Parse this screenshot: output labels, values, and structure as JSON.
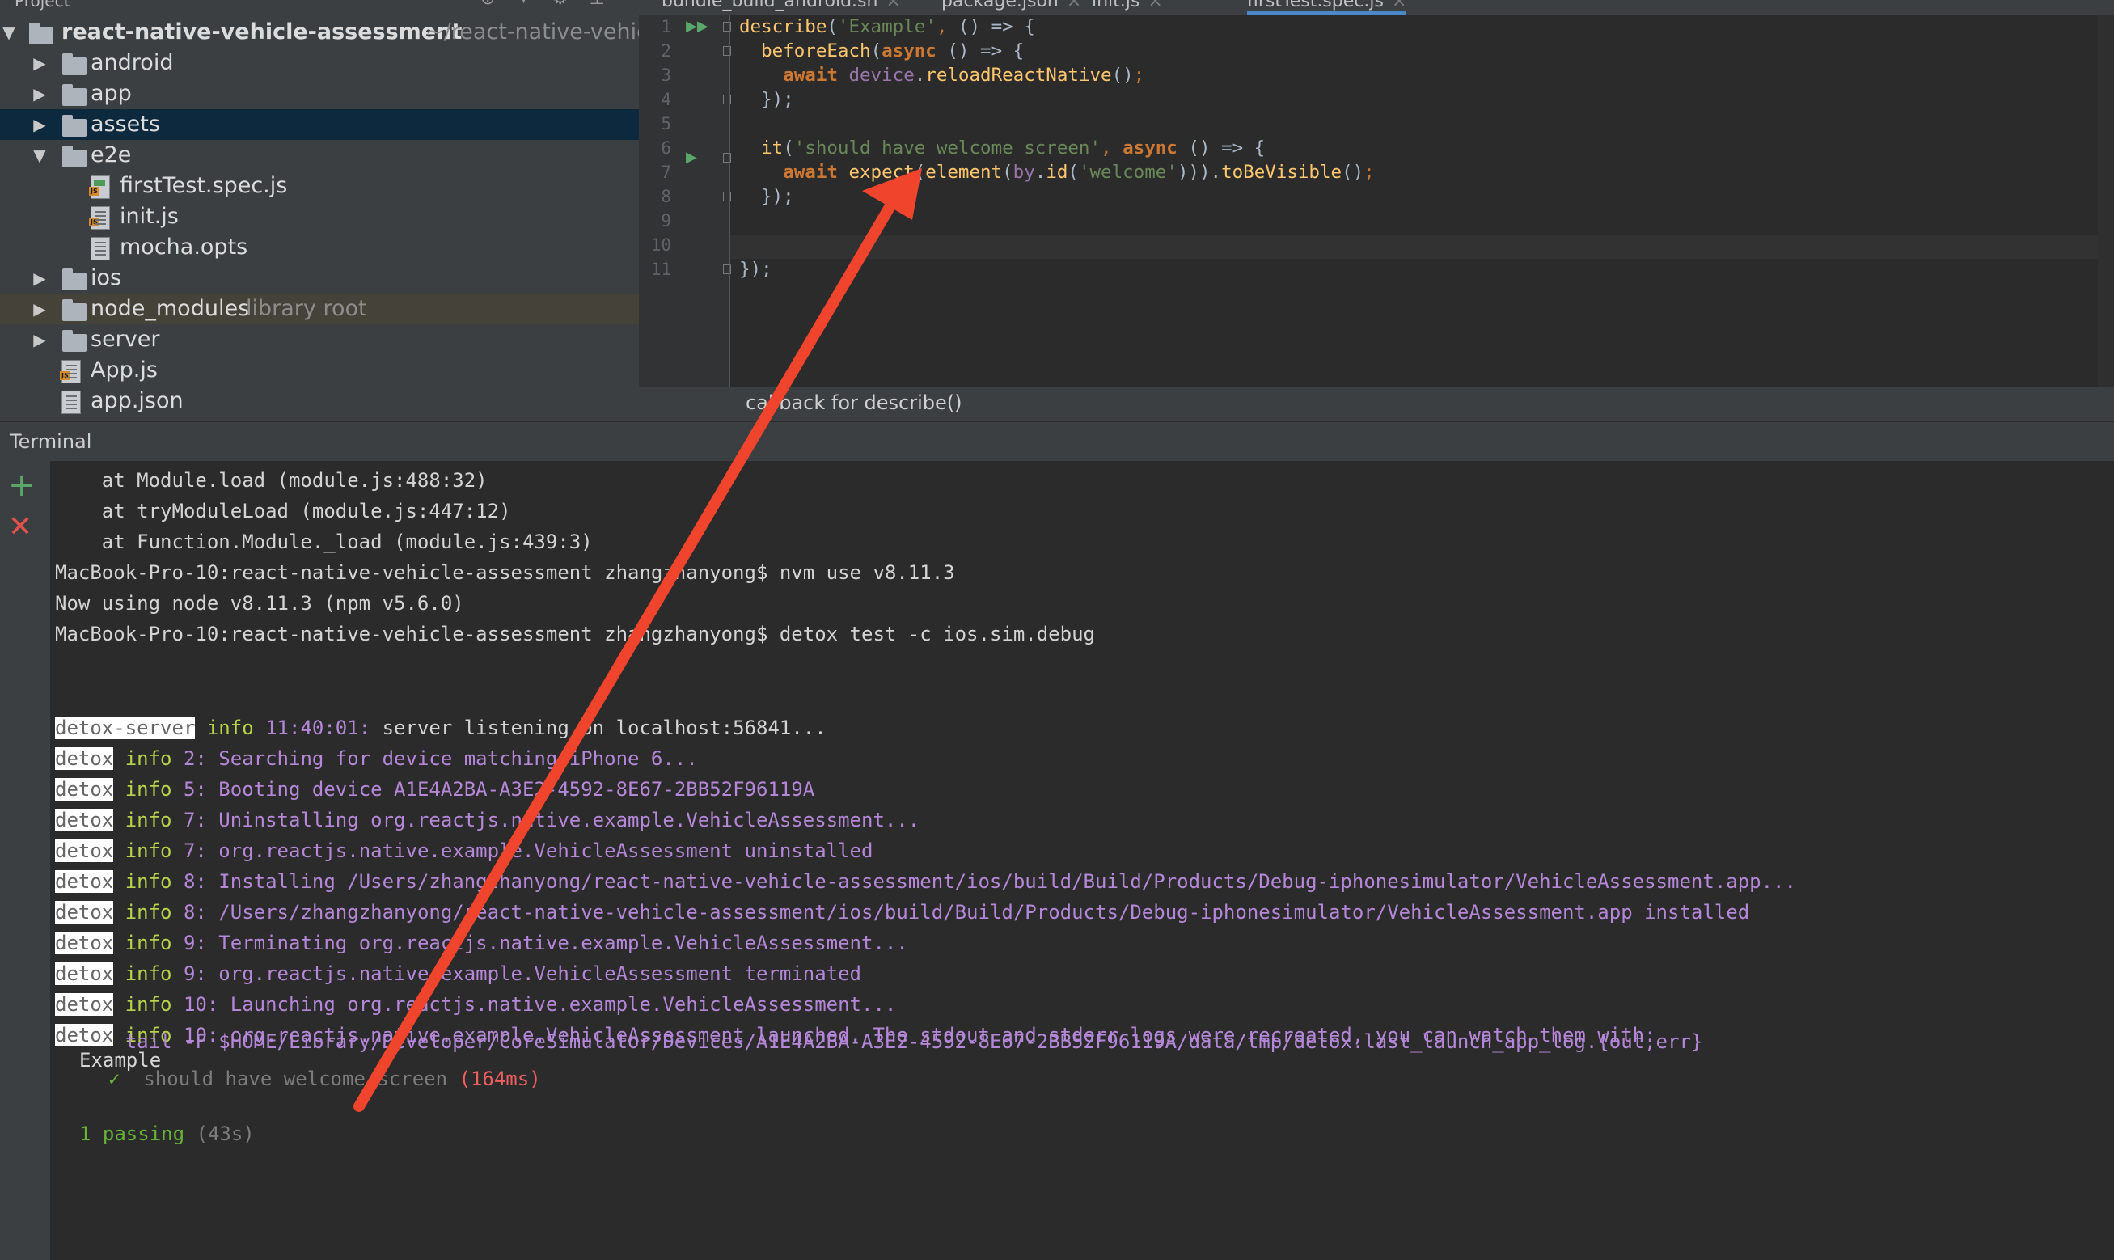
{
  "project": {
    "header_label": "Project",
    "root_name": "react-native-vehicle-assessment",
    "root_path": "~/react-native-vehicle-assessment",
    "items": [
      {
        "label": "android"
      },
      {
        "label": "app"
      },
      {
        "label": "assets"
      },
      {
        "label": "e2e"
      },
      {
        "label": "firstTest.spec.js"
      },
      {
        "label": "init.js"
      },
      {
        "label": "mocha.opts"
      },
      {
        "label": "ios"
      },
      {
        "label": "node_modules",
        "hint": "library root"
      },
      {
        "label": "server"
      },
      {
        "label": "App.js"
      },
      {
        "label": "app.json"
      }
    ],
    "file_tag": "JS"
  },
  "editor": {
    "tabs": [
      {
        "label": "bundle_build_android.sh"
      },
      {
        "label": "package.json"
      },
      {
        "label": "init.js"
      },
      {
        "label": "firstTest.spec.js",
        "active": true
      }
    ],
    "line_numbers": [
      "1",
      "2",
      "3",
      "4",
      "5",
      "6",
      "7",
      "8",
      "9",
      "10",
      "11"
    ],
    "code": {
      "l1_fn": "describe",
      "l1_str": "'Example'",
      "l1_rest": " () => {",
      "l2_fn": "beforeEach",
      "l2_kw": "async",
      "l2_rest": " () => {",
      "l3_kw": "await",
      "l3_var": "device",
      "l3_fn": "reloadReactNative",
      "l4": "});",
      "l6_fn": "it",
      "l6_str": "'should have welcome screen'",
      "l6_kw": "async",
      "l6_rest": " () => {",
      "l7_kw": "await",
      "l7_fn1": "expect",
      "l7_fn2": "element",
      "l7_var": "by",
      "l7_fn3": "id",
      "l7_str": "'welcome'",
      "l7_fn4": "toBeVisible",
      "l8": "});",
      "l11": "});"
    },
    "breadcrumb_hint": "callback for describe()"
  },
  "terminal": {
    "title": "Terminal",
    "lines": [
      "    at Module.load (module.js:488:32)",
      "    at tryModuleLoad (module.js:447:12)",
      "    at Function.Module._load (module.js:439:3)",
      "MacBook-Pro-10:react-native-vehicle-assessment zhangzhanyong$ nvm use v8.11.3",
      "Now using node v8.11.3 (npm v5.6.0)",
      "MacBook-Pro-10:react-native-vehicle-assessment zhangzhanyong$ detox test -c ios.sim.debug"
    ],
    "server_log": {
      "badge": "detox-server",
      "level": "info",
      "time": "11:40:01:",
      "msg": " server listening on localhost:56841..."
    },
    "detox_logs": [
      {
        "badge": "detox",
        "level": "info",
        "msg": "2: Searching for device matching iPhone 6..."
      },
      {
        "badge": "detox",
        "level": "info",
        "msg": "5: Booting device A1E4A2BA-A3E2-4592-8E67-2BB52F96119A"
      },
      {
        "badge": "detox",
        "level": "info",
        "msg": "7: Uninstalling org.reactjs.native.example.VehicleAssessment..."
      },
      {
        "badge": "detox",
        "level": "info",
        "msg": "7: org.reactjs.native.example.VehicleAssessment uninstalled"
      },
      {
        "badge": "detox",
        "level": "info",
        "msg": "8: Installing /Users/zhangzhanyong/react-native-vehicle-assessment/ios/build/Build/Products/Debug-iphonesimulator/VehicleAssessment.app..."
      },
      {
        "badge": "detox",
        "level": "info",
        "msg": "8: /Users/zhangzhanyong/react-native-vehicle-assessment/ios/build/Build/Products/Debug-iphonesimulator/VehicleAssessment.app installed"
      },
      {
        "badge": "detox",
        "level": "info",
        "msg": "9: Terminating org.reactjs.native.example.VehicleAssessment..."
      },
      {
        "badge": "detox",
        "level": "info",
        "msg": "9: org.reactjs.native.example.VehicleAssessment terminated"
      },
      {
        "badge": "detox",
        "level": "info",
        "msg": "10: Launching org.reactjs.native.example.VehicleAssessment..."
      },
      {
        "badge": "detox",
        "level": "info",
        "msg": "10: org.reactjs.native.example.VehicleAssessment launched. The stdout and stderr logs were recreated, you can watch them with:"
      }
    ],
    "tail_line": "      tail -F $HOME/Library/Developer/CoreSimulator/Devices/A1E4A2BA-A3E2-4592-8E67-2BB52F96119A/data/tmp/detox.last_launch_app_log.{out,err}",
    "suite_name": "Example",
    "test_check": "✓",
    "test_name": "should have welcome screen",
    "test_time": "(164ms)",
    "summary_count": "1 passing",
    "summary_time": "(43s)"
  },
  "colors": {
    "annotation_arrow": "#f0442c"
  }
}
